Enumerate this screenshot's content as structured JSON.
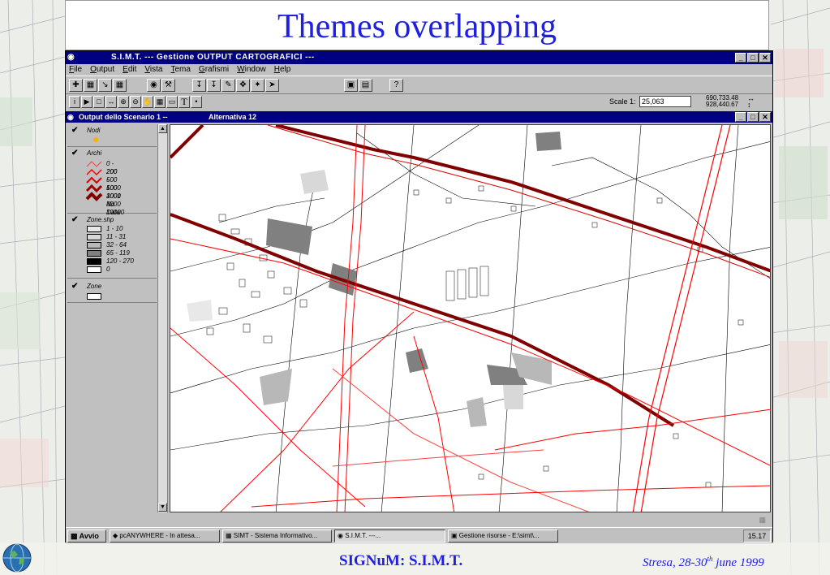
{
  "slide": {
    "title": "Themes overlapping",
    "footer_title": "SIGNuM: S.I.M.T.",
    "footer_date_prefix": "Stresa, 28-30",
    "footer_date_sup": "th",
    "footer_date_suffix": " june 1999",
    "logo_icon": "signum-globe-logo"
  },
  "app": {
    "title": "S.I.M.T.     --- Gestione OUTPUT CARTOGRAFICI ---",
    "window_buttons": [
      "_",
      "□",
      "✕"
    ],
    "menu": [
      "File",
      "Output",
      "Edit",
      "Vista",
      "Tema",
      "Grafismi",
      "Window",
      "Help"
    ],
    "toolbar_icons": [
      "add-theme-icon",
      "properties-icon",
      "edit-legend-icon",
      "table-icon",
      "find-icon",
      "query-icon",
      "zoom-full-icon",
      "zoom-active-icon",
      "zoom-selected-icon",
      "zoom-in-fixed-icon",
      "zoom-out-fixed-icon",
      "zoom-previous-icon",
      "layout-icon",
      "legend-icon",
      "help-icon"
    ],
    "tool_icons": [
      "identify-icon",
      "pointer-icon",
      "vertex-icon",
      "measure-icon",
      "zoom-in-icon",
      "zoom-out-icon",
      "pan-icon",
      "area-select-icon",
      "label-icon",
      "text-icon",
      "point-icon"
    ],
    "scale_label": "Scale 1:",
    "scale_value": "25,063",
    "coord_x": "690,733.48",
    "coord_y": "928,440.67"
  },
  "view": {
    "title_a": "Output dello Scenario 1     --",
    "title_b": "Alternativa 12",
    "themes": [
      {
        "name": "Nodi",
        "classes": []
      },
      {
        "name": "Archi",
        "classes": [
          "0 - 200",
          "200 - 500",
          "500 - 1000",
          "1000 - 3000",
          "3001 - 10000",
          "No Data"
        ]
      },
      {
        "name": "Zone.shp",
        "classes": [
          "1 - 10",
          "11 - 31",
          "32 - 64",
          "65 - 119",
          "120 - 270",
          "0"
        ]
      },
      {
        "name": "Zone",
        "classes": []
      }
    ],
    "arc_colors": [
      "#ff4040",
      "#ff0000",
      "#e00000",
      "#a00000",
      "#800000"
    ],
    "zone_colors": [
      "#e8e8e8",
      "#d8d8d8",
      "#b8b8b8",
      "#808080",
      "#000000",
      "#ffffff"
    ]
  },
  "taskbar": {
    "start": "Avvio",
    "tasks": [
      "pcANYWHERE - In attesa...",
      "SIMT - Sistema Informativo...",
      "S.I.M.T.      ---...",
      "Gestione risorse - E:\\simt\\..."
    ],
    "clock": "15.17"
  }
}
